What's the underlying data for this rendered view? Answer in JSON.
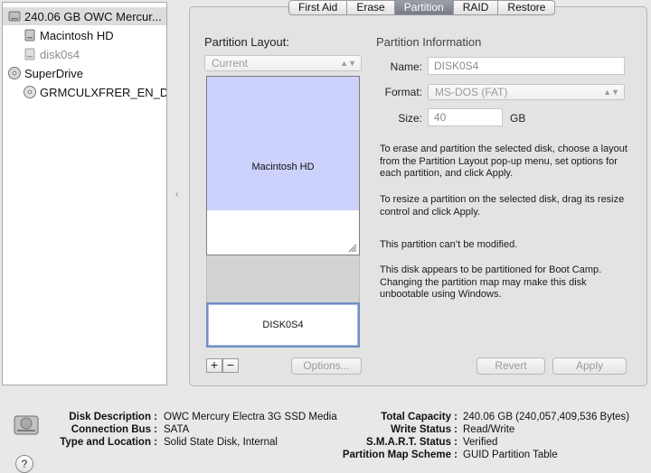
{
  "sidebar": {
    "items": [
      {
        "label": "240.06 GB OWC Mercur...",
        "icon": "hard-disk-icon",
        "selected": true
      },
      {
        "label": "Macintosh HD",
        "icon": "volume-icon"
      },
      {
        "label": "disk0s4",
        "icon": "volume-icon",
        "dimmed": true
      },
      {
        "label": "SuperDrive",
        "icon": "optical-drive-icon"
      },
      {
        "label": "GRMCULXFRER_EN_DVD",
        "icon": "disc-icon"
      }
    ]
  },
  "tabs": [
    {
      "label": "First Aid"
    },
    {
      "label": "Erase"
    },
    {
      "label": "Partition",
      "active": true
    },
    {
      "label": "RAID"
    },
    {
      "label": "Restore"
    }
  ],
  "partition_layout": {
    "title": "Partition Layout:",
    "popup_value": "Current",
    "partitions": [
      {
        "name": "Macintosh HD",
        "used_fraction": 0.75
      },
      {
        "name": "DISK0S4",
        "selected": true
      }
    ],
    "add_label": "+",
    "remove_label": "−",
    "options_label": "Options..."
  },
  "partition_info": {
    "title": "Partition Information",
    "name_label": "Name:",
    "name_value": "DISK0S4",
    "format_label": "Format:",
    "format_value": "MS-DOS (FAT)",
    "size_label": "Size:",
    "size_value": "40",
    "size_unit": "GB",
    "paragraphs": [
      "To erase and partition the selected disk, choose a layout from the Partition Layout pop-up menu, set options for each partition, and click Apply.",
      "To resize a partition on the selected disk, drag its resize control and click Apply.",
      "This partition can’t be modified.",
      "This disk appears to be partitioned for Boot Camp. Changing the partition map may make this disk unbootable using Windows."
    ]
  },
  "buttons": {
    "revert": "Revert",
    "apply": "Apply"
  },
  "disk_info": {
    "left": [
      {
        "label": "Disk Description :",
        "value": "OWC Mercury Electra 3G SSD Media"
      },
      {
        "label": "Connection Bus :",
        "value": "SATA"
      },
      {
        "label": "Type and Location :",
        "value": "Solid State Disk, Internal"
      }
    ],
    "right": [
      {
        "label": "Total Capacity :",
        "value": "240.06 GB (240,057,409,536 Bytes)"
      },
      {
        "label": "Write Status :",
        "value": "Read/Write"
      },
      {
        "label": "S.M.A.R.T. Status :",
        "value": "Verified"
      },
      {
        "label": "Partition Map Scheme :",
        "value": "GUID Partition Table"
      }
    ]
  },
  "help_label": "?"
}
